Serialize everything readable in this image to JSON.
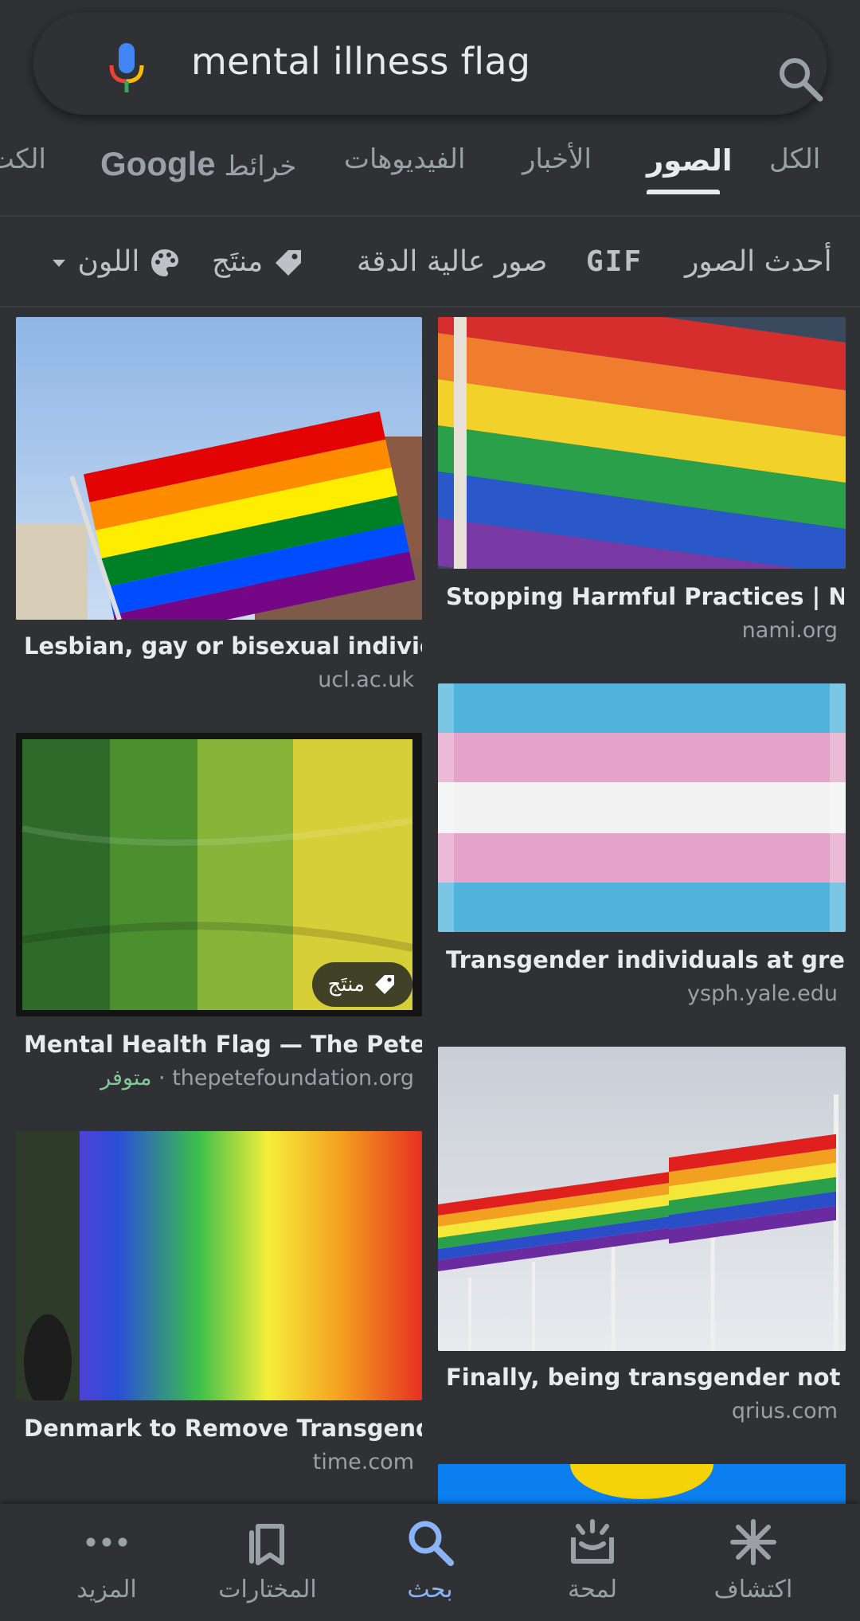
{
  "search": {
    "query": "mental illness flag",
    "mic_icon": "mic-icon",
    "search_icon": "search-icon"
  },
  "tabs": [
    {
      "label": "الكل",
      "active": false
    },
    {
      "label": "الصور",
      "active": true
    },
    {
      "label": "الأخبار",
      "active": false
    },
    {
      "label": "الفيديوهات",
      "active": false
    },
    {
      "label_prefix": "Google",
      "label": "خرائط",
      "active": false
    },
    {
      "label": "الكت",
      "active": false
    }
  ],
  "filters": {
    "recent": "أحدث الصور",
    "gif": "GIF",
    "hd": "صور عالية الدقة",
    "product": "منتَج",
    "color": "اللون"
  },
  "results": [
    {
      "title": "Lesbian, gay or bisexual individ...",
      "source": "ucl.ac.uk"
    },
    {
      "title": "Stopping Harmful Practices | N...",
      "source": "nami.org"
    },
    {
      "title": "Mental Health Flag — The Pete ...",
      "source": "thepetefoundation.org",
      "availability": "متوفر",
      "badge": "منتَج"
    },
    {
      "title": "Transgender individuals at grea...",
      "source": "ysph.yale.edu"
    },
    {
      "title": "Denmark to Remove Transgend...",
      "source": "time.com"
    },
    {
      "title": "Finally, being transgender not a ...",
      "source": "qrius.com"
    }
  ],
  "bottom_nav": [
    {
      "label": "اكتشاف",
      "icon": "asterisk-icon"
    },
    {
      "label": "لمحة",
      "icon": "snapshot-icon"
    },
    {
      "label": "بحث",
      "icon": "search-icon",
      "active": true
    },
    {
      "label": "المختارات",
      "icon": "bookmarks-icon"
    },
    {
      "label": "المزيد",
      "icon": "more-icon"
    }
  ],
  "colors": {
    "background": "#303134",
    "text": "#e8eaed",
    "muted": "#9aa0a6",
    "accent": "#8ab4f8",
    "available": "#81c995"
  }
}
